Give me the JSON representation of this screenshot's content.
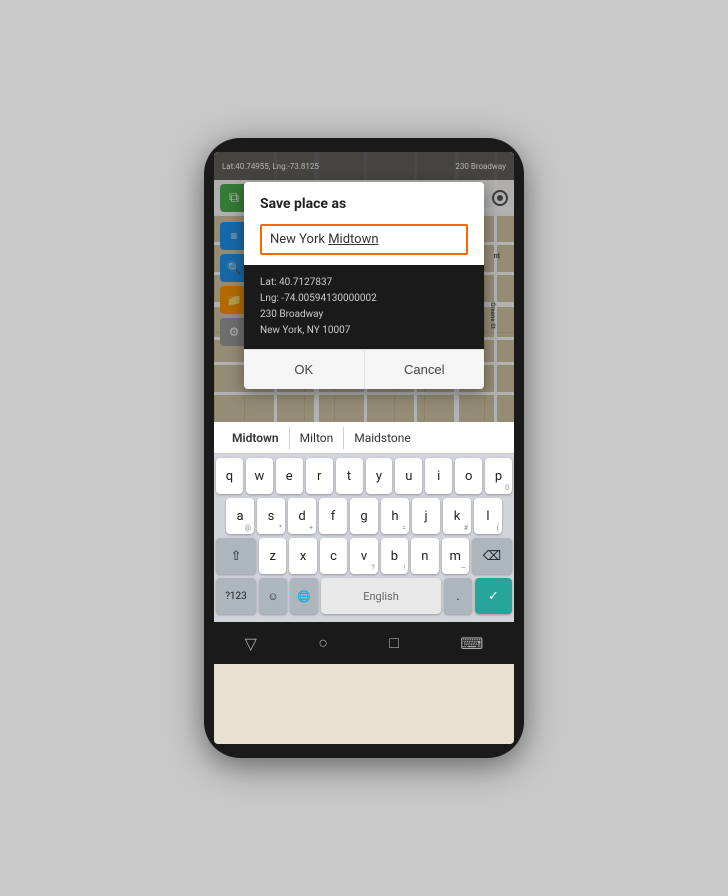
{
  "phone": {
    "statusBar": {
      "coords": "Lat:40.74955, Lng:-73.8125",
      "address": "230 Broadway"
    }
  },
  "dialog": {
    "title": "Save place as",
    "inputValue": "New York Midtown",
    "inputValuePart1": "New York ",
    "inputValuePart2": "Midtown",
    "info": {
      "lat": "Lat: 40.7127837",
      "lng": "Lng: -74.00594130000002",
      "street": "230 Broadway",
      "city": "New York, NY 10007"
    },
    "okButton": "OK",
    "cancelButton": "Cancel"
  },
  "suggestions": [
    "Midtown",
    "Milton",
    "Maidstone"
  ],
  "keyboard": {
    "rows": [
      [
        "q",
        "w",
        "e",
        "r",
        "t",
        "y",
        "u",
        "i",
        "o",
        "p"
      ],
      [
        "a",
        "s",
        "d",
        "f",
        "g",
        "h",
        "j",
        "k",
        "l"
      ],
      [
        "z",
        "x",
        "c",
        "v",
        "b",
        "n",
        "m"
      ]
    ],
    "subLabels": {
      "q": "",
      "w": "",
      "e": "",
      "r": "",
      "t": "",
      "y": "",
      "u": "",
      "i": "",
      "o": "",
      "p": "0",
      "a": "@",
      "s": "*",
      "d": "+",
      "f": "",
      "g": "",
      "h": "=",
      "j": "",
      "k": "#",
      "l": "(",
      "z": "",
      "x": "",
      "c": "",
      "v": "?",
      "b": "!",
      "n": "",
      "m": "—"
    },
    "specialKeys": {
      "symbols": "?123",
      "emoji": "☺",
      "globe": "🌐",
      "spacebar": "English",
      "period": ".",
      "delete": "⌫",
      "shift": "⇧",
      "enter": "✓"
    }
  },
  "navBar": {
    "back": "▽",
    "home": "○",
    "recent": "□",
    "keyboard": "⌨"
  },
  "colors": {
    "orange": "#ff6600",
    "teal": "#26a69a",
    "darkBg": "#1a1a1a"
  }
}
